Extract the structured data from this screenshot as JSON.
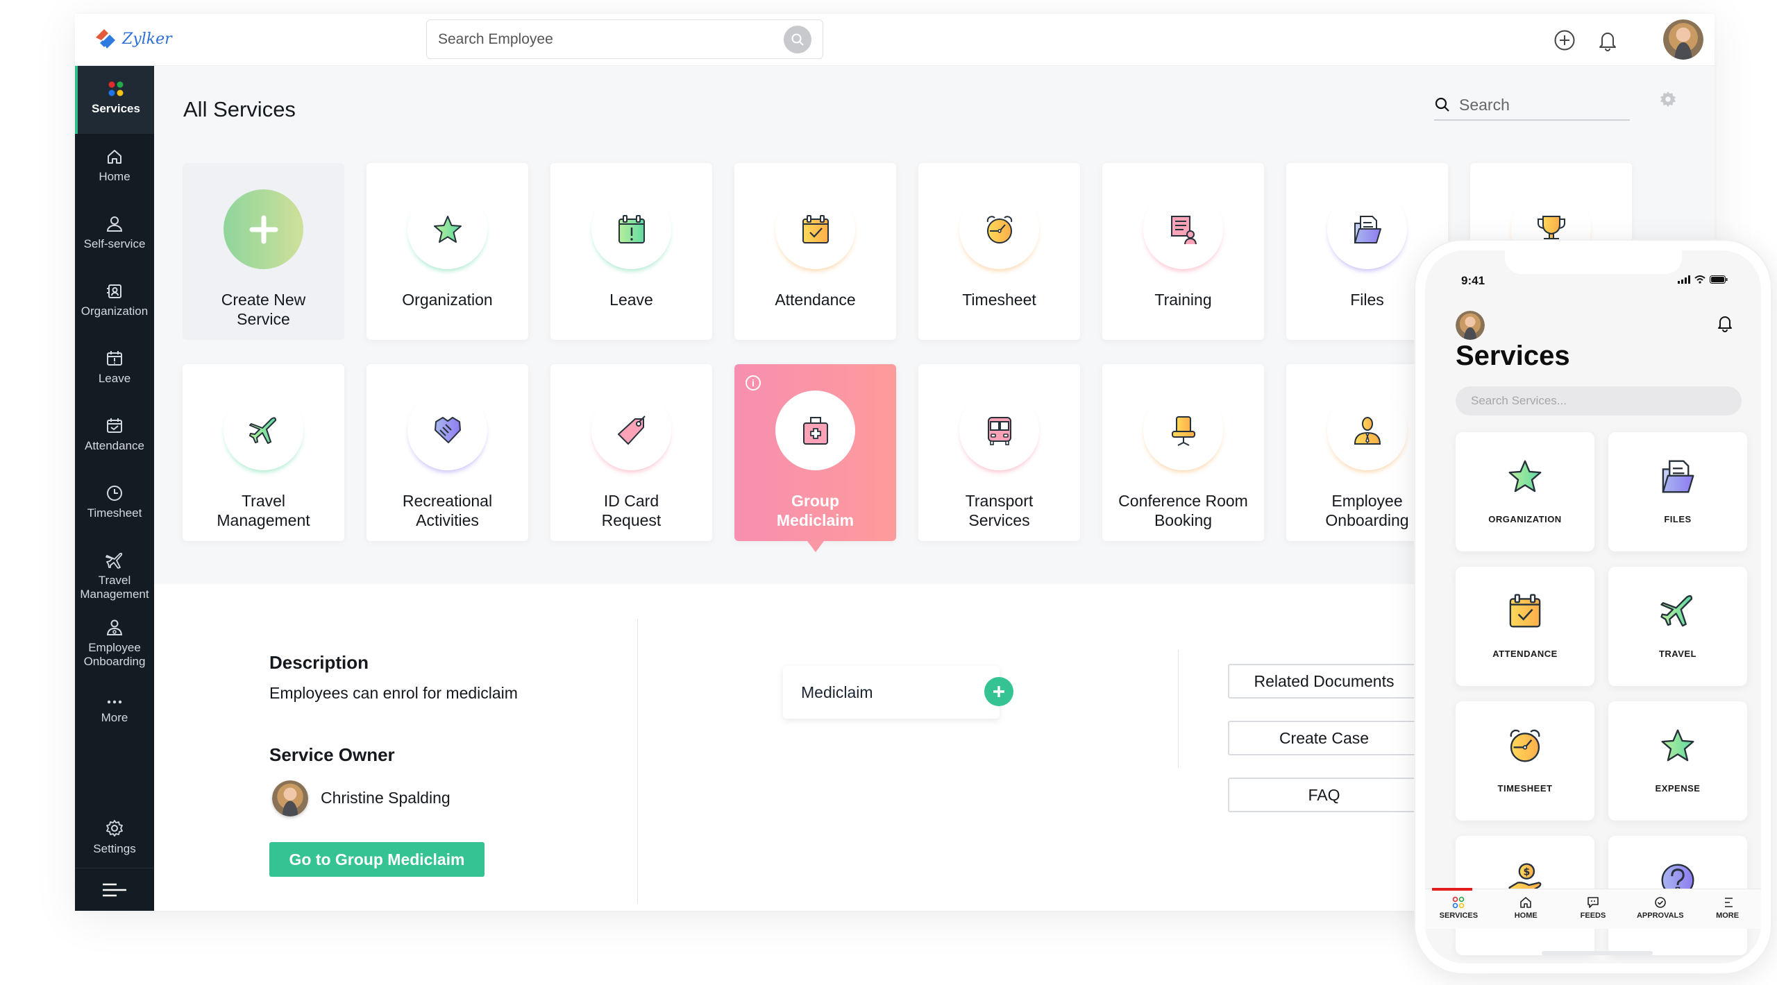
{
  "brand": {
    "name": "Zylker"
  },
  "header": {
    "search_placeholder": "Search Employee",
    "icons": [
      "add-circle-icon",
      "bell-icon",
      "user-avatar"
    ]
  },
  "sidebar": {
    "items": [
      {
        "label": "Services",
        "icon": "services-dots-icon",
        "active": true
      },
      {
        "label": "Home",
        "icon": "home-icon"
      },
      {
        "label": "Self-service",
        "icon": "person-icon"
      },
      {
        "label": "Organization",
        "icon": "org-card-icon"
      },
      {
        "label": "Leave",
        "icon": "calendar-alert-icon"
      },
      {
        "label": "Attendance",
        "icon": "calendar-check-icon"
      },
      {
        "label": "Timesheet",
        "icon": "clock-icon"
      },
      {
        "label": "Travel Management",
        "icon": "plane-icon"
      },
      {
        "label": "Employee Onboarding",
        "icon": "people-icon"
      },
      {
        "label": "More",
        "icon": "more-dots-icon"
      },
      {
        "label": "Settings",
        "icon": "gear-icon"
      }
    ],
    "collapse_icon": "menu-lines-icon"
  },
  "main": {
    "title": "All Services",
    "search_placeholder": "Search",
    "settings_icon": "gear-icon",
    "services": [
      {
        "label": "Create New Service",
        "icon": "plus-icon",
        "type": "create"
      },
      {
        "label": "Organization",
        "icon": "star-icon",
        "accent": "#9ee6c6"
      },
      {
        "label": "Leave",
        "icon": "calendar-alert-icon",
        "accent": "#9ee6c6"
      },
      {
        "label": "Attendance",
        "icon": "calendar-check-icon",
        "accent": "#fcd0a2"
      },
      {
        "label": "Timesheet",
        "icon": "alarm-clock-icon",
        "accent": "#fcd0a2"
      },
      {
        "label": "Training",
        "icon": "training-board-icon",
        "accent": "#fbb9c7"
      },
      {
        "label": "Files",
        "icon": "folder-icon",
        "accent": "#c0b5f5"
      },
      {
        "label": "",
        "icon": "trophy-icon",
        "accent": "#fcd0a2"
      },
      {
        "label": "Travel Management",
        "icon": "plane-icon",
        "accent": "#9ee6c6"
      },
      {
        "label": "Recreational Activities",
        "icon": "handshake-icon",
        "accent": "#c0b5f5"
      },
      {
        "label": "ID Card Request",
        "icon": "tag-icon",
        "accent": "#fbb9c7"
      },
      {
        "label": "Group Mediclaim",
        "icon": "medical-kit-icon",
        "selected": true
      },
      {
        "label": "Transport Services",
        "icon": "bus-icon",
        "accent": "#fbb9c7"
      },
      {
        "label": "Conference Room Booking",
        "icon": "office-chair-icon",
        "accent": "#fcd0a2"
      },
      {
        "label": "Employee Onboarding",
        "icon": "employee-icon",
        "accent": "#fcd0a2"
      }
    ]
  },
  "detail": {
    "description_heading": "Description",
    "description_text": "Employees can enrol for mediclaim",
    "owner_heading": "Service Owner",
    "owner_name": "Christine Spalding",
    "go_button": "Go to Group Mediclaim",
    "tag_label": "Mediclaim",
    "links": [
      "Related Documents",
      "Create Case",
      "FAQ"
    ]
  },
  "phone": {
    "time": "9:41",
    "title": "Services",
    "search_placeholder": "Search Services...",
    "tiles": [
      {
        "label": "ORGANIZATION",
        "icon": "star-icon"
      },
      {
        "label": "FILES",
        "icon": "folder-icon"
      },
      {
        "label": "ATTENDANCE",
        "icon": "calendar-check-icon"
      },
      {
        "label": "TRAVEL",
        "icon": "plane-icon"
      },
      {
        "label": "TIMESHEET",
        "icon": "alarm-clock-icon"
      },
      {
        "label": "EXPENSE",
        "icon": "star-icon"
      },
      {
        "label": "",
        "icon": "money-hand-icon"
      },
      {
        "label": "",
        "icon": "help-icon"
      }
    ],
    "nav": [
      {
        "label": "SERVICES",
        "icon": "services-dots-icon",
        "active": true
      },
      {
        "label": "HOME",
        "icon": "home-icon"
      },
      {
        "label": "FEEDS",
        "icon": "chat-icon"
      },
      {
        "label": "APPROVALS",
        "icon": "check-circle-icon"
      },
      {
        "label": "MORE",
        "icon": "menu-lines-icon"
      }
    ]
  },
  "colors": {
    "accent_green": "#35c394",
    "sidebar_bg": "#131b23",
    "selected_card_start": "#f78fb0",
    "selected_card_end": "#fd9b9b",
    "nav_active": "#e41e1e"
  }
}
